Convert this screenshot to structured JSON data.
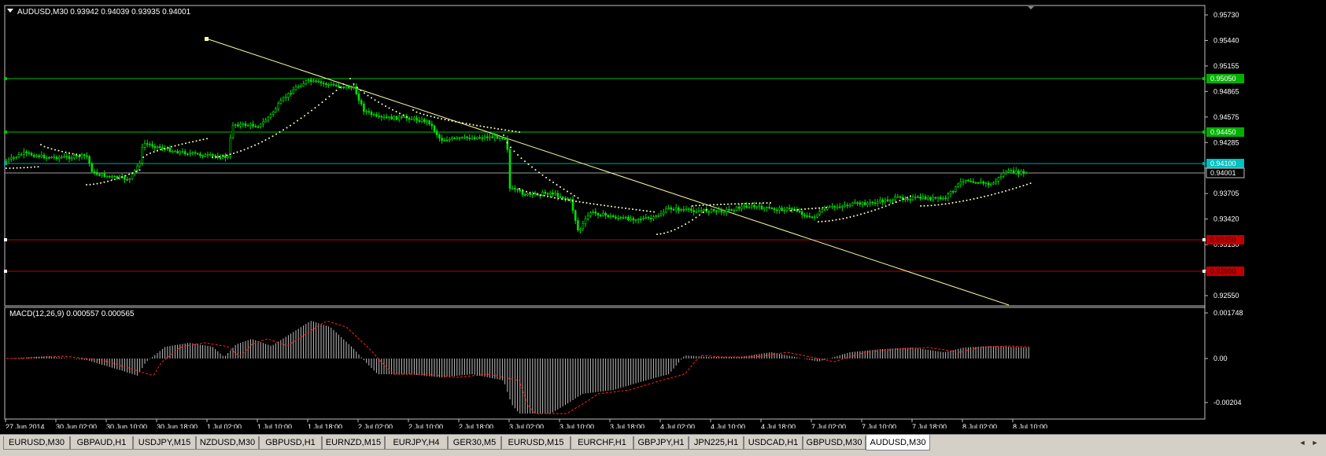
{
  "main_chart": {
    "header": {
      "symbol": "AUDUSD,M30",
      "open": "0.93942",
      "high": "0.94039",
      "low": "0.93935",
      "close": "0.94001"
    },
    "price_labels": [
      "0.95730",
      "0.95440",
      "0.95155",
      "0.94865",
      "0.94575",
      "0.94285",
      "0.93995",
      "0.93705",
      "0.93420",
      "0.93130",
      "0.92840",
      "0.92550"
    ],
    "level_tags": [
      {
        "text": "0.95050",
        "color": "#00b000"
      },
      {
        "text": "0.94450",
        "color": "#00b000"
      },
      {
        "text": "0.94100",
        "color": "#00c0c0"
      },
      {
        "text": "0.94001",
        "color": "#000000"
      },
      {
        "text": "0.93250",
        "color": "#c00000"
      },
      {
        "text": "0.92900",
        "color": "#c00000"
      }
    ]
  },
  "macd": {
    "label": "MACD(12,26,9) 0.000557 0.000565",
    "scale_labels": [
      "0.001748",
      "0.00",
      "-0.00204"
    ]
  },
  "time_labels": [
    "27 Jun 2014",
    "30 Jun 02:00",
    "30 Jun 10:00",
    "30 Jun 18:00",
    "1 Jul 02:00",
    "1 Jul 10:00",
    "1 Jul 18:00",
    "2 Jul 02:00",
    "2 Jul 10:00",
    "2 Jul 18:00",
    "3 Jul 02:00",
    "3 Jul 10:00",
    "3 Jul 18:00",
    "4 Jul 02:00",
    "4 Jul 10:00",
    "4 Jul 18:00",
    "7 Jul 02:00",
    "7 Jul 10:00",
    "7 Jul 18:00",
    "8 Jul 02:00",
    "8 Jul 10:00"
  ],
  "tabs": [
    "EURUSD,M30",
    "GBPAUD,H1",
    "USDJPY,M15",
    "NZDUSD,M30",
    "GBPUSD,H1",
    "EURNZD,M15",
    "EURJPY,H4",
    "GER30,M5",
    "EURUSD,M15",
    "EURCHF,H1",
    "GBPJPY,H1",
    "JPN225,H1",
    "USDCAD,H1",
    "GBPUSD,M30",
    "AUDUSD,M30"
  ],
  "active_tab": "AUDUSD,M30",
  "colors": {
    "bull": "#00e000",
    "bear": "#00e000",
    "grid": "#c0c0c0",
    "sar": "#ffffc0",
    "trendline": "#ffffa0",
    "macd_hist": "#c0c0c0",
    "macd_signal": "#ff2020"
  },
  "icons": {
    "symbol_menu": "triangle-down-icon",
    "scroll_left": "chevron-left-icon",
    "scroll_right": "chevron-right-icon"
  }
}
